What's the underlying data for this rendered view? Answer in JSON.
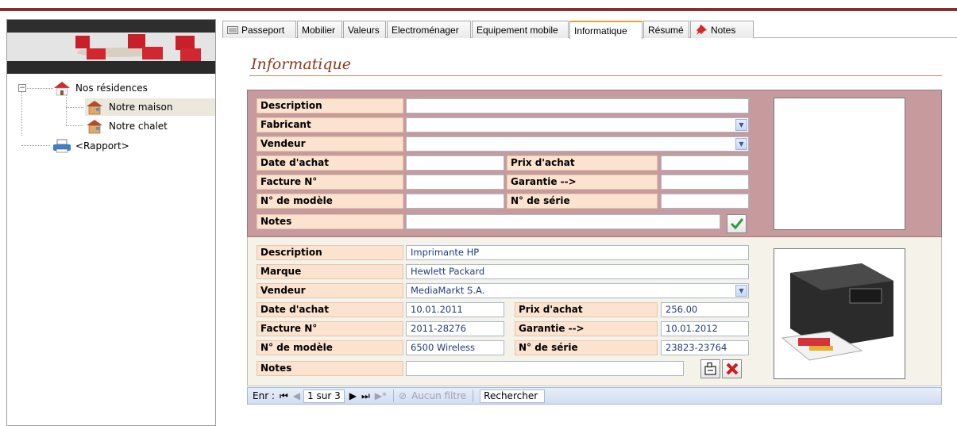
{
  "tree": {
    "root_label": "Nos résidences",
    "items": [
      {
        "label": "Notre maison",
        "selected": true
      },
      {
        "label": "Notre chalet",
        "selected": false
      }
    ],
    "report_label": "<Rapport>"
  },
  "tabs": [
    {
      "label": "Passeport"
    },
    {
      "label": "Mobilier"
    },
    {
      "label": "Valeurs"
    },
    {
      "label": "Electroménager"
    },
    {
      "label": "Equipement mobile"
    },
    {
      "label": "Informatique",
      "active": true
    },
    {
      "label": "Résumé"
    },
    {
      "label": "Notes"
    }
  ],
  "form": {
    "title": "Informatique",
    "new_record": {
      "description_label": "Description",
      "fabricant_label": "Fabricant",
      "vendeur_label": "Vendeur",
      "date_achat_label": "Date d'achat",
      "prix_achat_label": "Prix d'achat",
      "facture_label": "Facture N°",
      "garantie_label": "Garantie -->",
      "modele_label": "N° de modèle",
      "serie_label": "N° de série",
      "notes_label": "Notes",
      "description": "",
      "fabricant": "",
      "vendeur": "",
      "date_achat": "",
      "prix_achat": "",
      "facture": "",
      "garantie": "",
      "modele": "",
      "serie": "",
      "notes": ""
    },
    "record": {
      "description_label": "Description",
      "marque_label": "Marque",
      "vendeur_label": "Vendeur",
      "date_achat_label": "Date d'achat",
      "prix_achat_label": "Prix d'achat",
      "facture_label": "Facture N°",
      "garantie_label": "Garantie -->",
      "modele_label": "N° de modèle",
      "serie_label": "N° de série",
      "notes_label": "Notes",
      "description": "Imprimante HP",
      "marque": "Hewlett Packard",
      "vendeur": "MediaMarkt S.A.",
      "date_achat": "10.01.2011",
      "prix_achat": "256.00",
      "facture": "2011-28276",
      "garantie": "10.01.2012",
      "modele": "6500 Wireless",
      "serie": "23823-23764",
      "notes": ""
    }
  },
  "navigator": {
    "record_label": "Enr :",
    "position": "1 sur 3",
    "filter_label": "Aucun filtre",
    "search_label": "Rechercher"
  },
  "icons": {
    "expander": "minus-box-icon",
    "home": "house-icon",
    "residence": "house-icon",
    "report": "printer-icon",
    "notes_tab": "pushpin-icon",
    "save": "checkmark-icon",
    "edit": "edit-icon",
    "delete": "delete-x-icon"
  },
  "colors": {
    "accent": "#8b2c2f",
    "label_bg": "#fbe3cf",
    "top_panel": "#c79a9d",
    "active_tab": "#f0a030"
  }
}
